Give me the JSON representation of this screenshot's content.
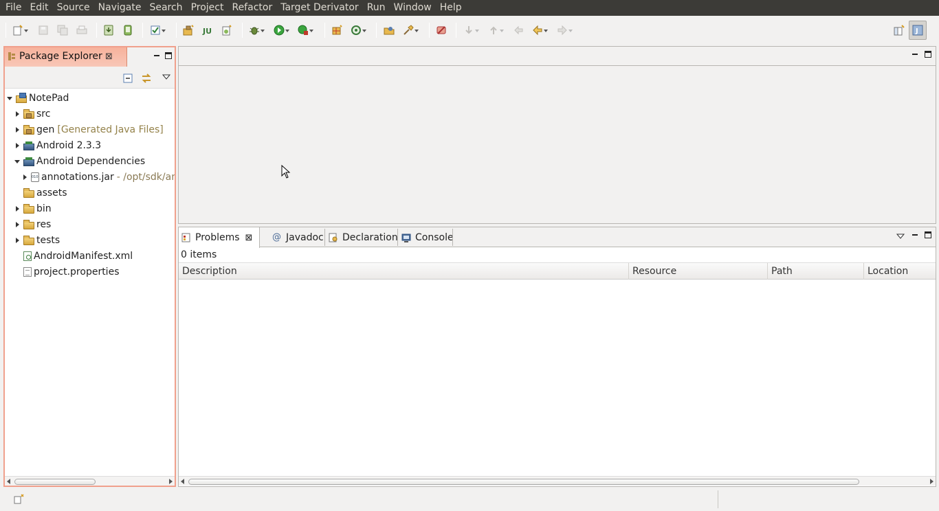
{
  "menubar": {
    "items": [
      "File",
      "Edit",
      "Source",
      "Navigate",
      "Search",
      "Project",
      "Refactor",
      "Target Derivator",
      "Run",
      "Window",
      "Help"
    ]
  },
  "toolbar": {
    "icons": [
      "new-icon",
      "save-icon",
      "save-all-icon",
      "print-icon",
      "android-sdk-manager-icon",
      "avd-manager-icon",
      "task-checkbox-icon",
      "new-java-package-icon",
      "new-junit-icon",
      "new-android-project-icon",
      "debug-icon",
      "run-icon",
      "run-external-icon",
      "new-java-class-icon",
      "refresh-icon",
      "open-type-icon",
      "search-icon",
      "skip-breakpoints-icon",
      "next-annotation-icon",
      "previous-annotation-icon",
      "last-edit-icon",
      "back-icon",
      "forward-icon",
      "open-perspective-icon",
      "java-perspective-icon"
    ]
  },
  "package_explorer": {
    "title": "Package Explorer",
    "tree": [
      {
        "label": "NotePad",
        "state": "open",
        "icon": "project-icon",
        "level": 0
      },
      {
        "label": "src",
        "state": "closed",
        "icon": "source-folder-icon",
        "level": 1
      },
      {
        "label": "gen",
        "decoration": "[Generated Java Files]",
        "state": "closed",
        "icon": "source-folder-icon",
        "level": 1
      },
      {
        "label": "Android 2.3.3",
        "state": "closed",
        "icon": "library-icon",
        "level": 1
      },
      {
        "label": "Android Dependencies",
        "state": "open",
        "icon": "library-icon",
        "level": 1
      },
      {
        "label": "annotations.jar",
        "path": "- /opt/sdk/an",
        "state": "closed",
        "icon": "jar-icon",
        "level": 2
      },
      {
        "label": "assets",
        "state": "none",
        "icon": "folder-icon",
        "level": 1
      },
      {
        "label": "bin",
        "state": "closed",
        "icon": "folder-icon",
        "level": 1
      },
      {
        "label": "res",
        "state": "closed",
        "icon": "folder-icon",
        "level": 1
      },
      {
        "label": "tests",
        "state": "closed",
        "icon": "folder-icon",
        "level": 1
      },
      {
        "label": "AndroidManifest.xml",
        "state": "none",
        "icon": "xml-file-icon",
        "level": 1
      },
      {
        "label": "project.properties",
        "state": "none",
        "icon": "properties-file-icon",
        "level": 1
      }
    ]
  },
  "bottom_view": {
    "tabs": [
      {
        "label": "Problems",
        "active": true,
        "icon": "problems-icon"
      },
      {
        "label": "Javadoc",
        "active": false,
        "icon": "at-icon"
      },
      {
        "label": "Declaration",
        "active": false,
        "icon": "declaration-icon"
      },
      {
        "label": "Console",
        "active": false,
        "icon": "console-icon"
      }
    ],
    "status": "0 items",
    "columns": [
      "Description",
      "Resource",
      "Path",
      "Location"
    ]
  },
  "colors": {
    "menubar_bg": "#3c3b37",
    "active_view_border": "#f0a08c",
    "window_bg": "#f2f1f0"
  }
}
